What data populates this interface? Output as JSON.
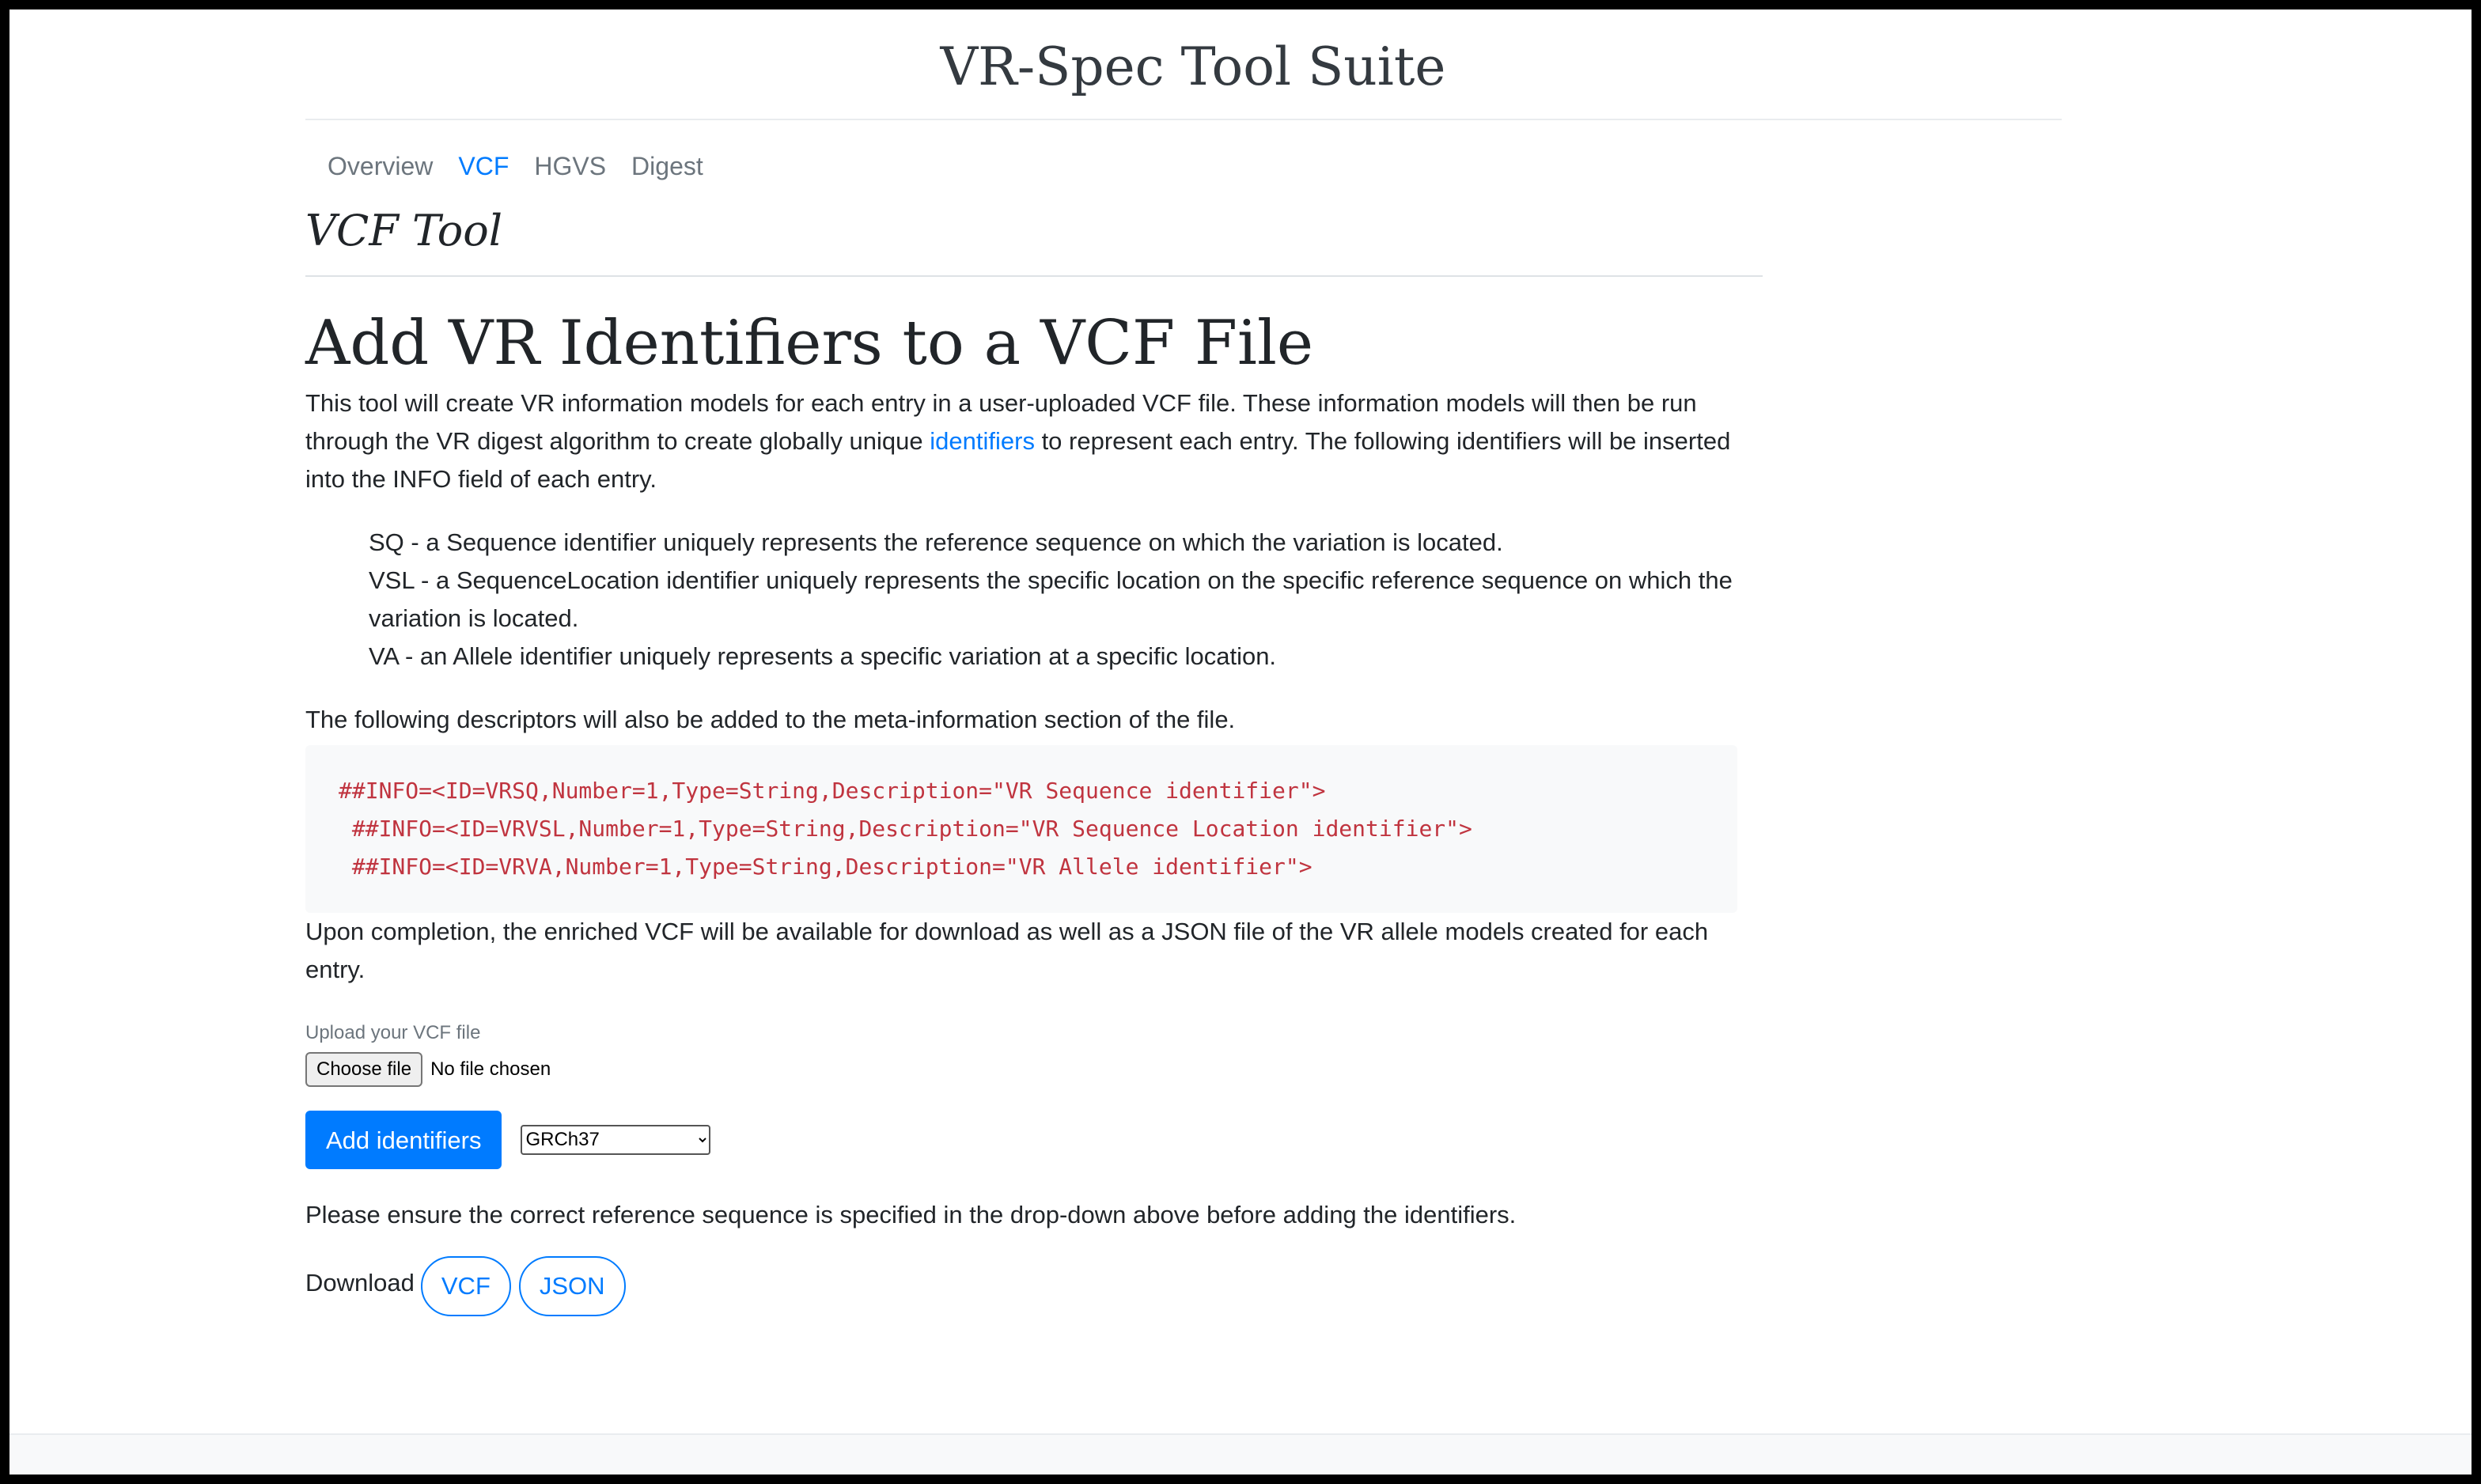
{
  "header": {
    "title": "VR-Spec Tool Suite"
  },
  "nav": {
    "items": [
      {
        "label": "Overview"
      },
      {
        "label": "VCF"
      },
      {
        "label": "HGVS"
      },
      {
        "label": "Digest"
      }
    ],
    "active": "VCF"
  },
  "page": {
    "tool_title": "VCF Tool"
  },
  "main": {
    "heading": "Add VR Identifiers to a VCF File",
    "intro_part1": "This tool will create VR information models for each entry in a user-uploaded VCF file. These information models will then be run through the VR digest algorithm to create globally unique ",
    "intro_link": "identifiers",
    "intro_part2": " to represent each entry. The following identifiers will be inserted into the INFO field of each entry.",
    "identifiers": [
      "SQ - a Sequence identifier uniquely represents the reference sequence on which the variation is located.",
      "VSL - a SequenceLocation identifier uniquely represents the specific location on the specific reference sequence on which the variation is located.",
      "VA - an Allele identifier uniquely represents a specific variation at a specific location."
    ],
    "descriptors_intro": "The following descriptors will also be added to the meta-information section of the file.",
    "code_lines": [
      "##INFO=<ID=VRSQ,Number=1,Type=String,Description=\"VR Sequence identifier\">",
      " ##INFO=<ID=VRVSL,Number=1,Type=String,Description=\"VR Sequence Location identifier\">",
      " ##INFO=<ID=VRVA,Number=1,Type=String,Description=\"VR Allele identifier\">"
    ],
    "completion": "Upon completion, the enriched VCF will be available for download as well as a JSON file of the VR allele models created for each entry."
  },
  "upload": {
    "label": "Upload your VCF file",
    "choose_button": "Choose file",
    "status": "No file chosen"
  },
  "actions": {
    "add_button": "Add identifiers",
    "reference_selected": "GRCh37",
    "reference_options": [
      "GRCh37"
    ]
  },
  "note": "Please ensure the correct reference sequence is specified in the drop-down above before adding the identifiers.",
  "download": {
    "label": "Download",
    "vcf_button": "VCF",
    "json_button": "JSON"
  },
  "colors": {
    "link": "#007bff",
    "primary": "#007bff",
    "code_text": "#c0343f",
    "code_bg": "#f8f9fa",
    "nav_muted": "#6c757d"
  }
}
